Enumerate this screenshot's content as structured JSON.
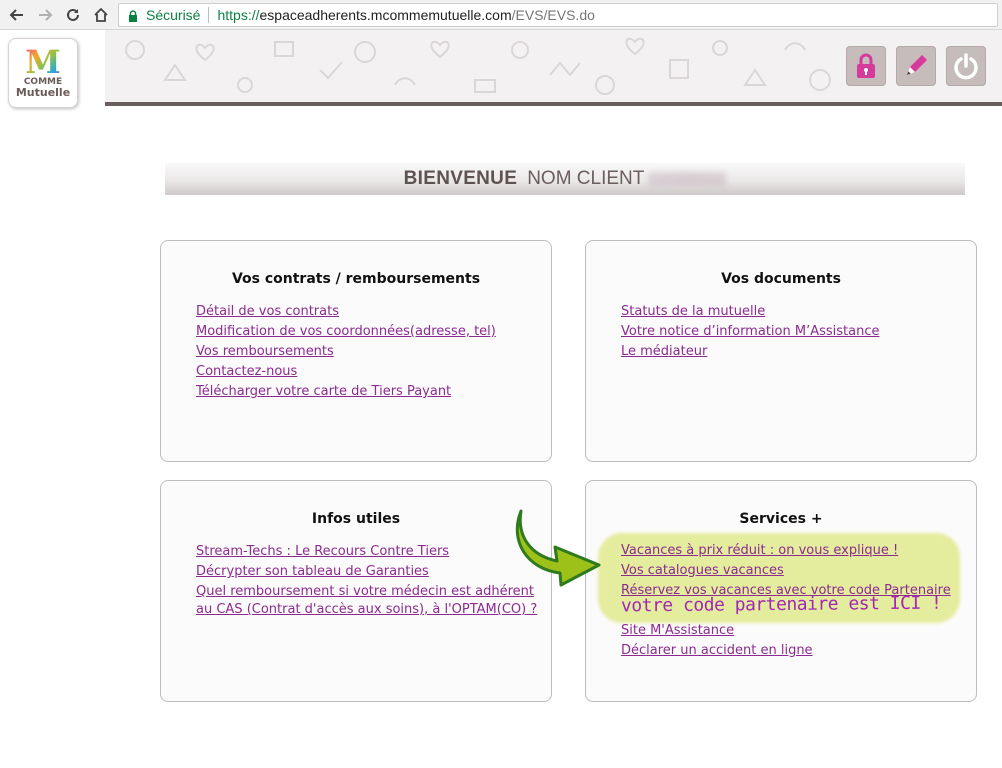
{
  "browser": {
    "secure_label": "Sécurisé",
    "url_scheme": "https://",
    "url_host": "espaceadherents.mcommemutuelle.com",
    "url_path": "/EVS/EVS.do"
  },
  "logo": {
    "letter": "M",
    "line1": "COMME",
    "line2": "Mutuelle"
  },
  "header": {
    "buttons": [
      {
        "name": "lock-icon",
        "color": "#d63a9a"
      },
      {
        "name": "pen-icon",
        "color": "#d63a9a"
      },
      {
        "name": "power-icon",
        "color": "#ffffff"
      }
    ]
  },
  "welcome": {
    "title": "BIENVENUE",
    "client_name": "NOM CLIENT"
  },
  "cards": {
    "contrats": {
      "title": "Vos contrats / remboursements",
      "links": [
        "Détail de vos contrats",
        "Modification de vos coordonnées(adresse, tel)",
        "Vos remboursements",
        "Contactez-nous",
        "Télécharger votre carte de Tiers Payant"
      ]
    },
    "documents": {
      "title": "Vos documents",
      "links": [
        "Statuts de la mutuelle",
        "Votre notice d’information M’Assistance",
        "Le médiateur"
      ]
    },
    "infos": {
      "title": "Infos utiles",
      "links": [
        "Stream-Techs : Le Recours Contre Tiers",
        "Décrypter son tableau de Garanties",
        "Quel remboursement si votre médecin est adhérent",
        "au CAS (Contrat d'accès aux soins), à l'OPTAM(CO) ?"
      ]
    },
    "services": {
      "title": "Services +",
      "links": [
        "Vacances à prix réduit : on vous explique !",
        "Vos catalogues vacances",
        "Réservez vos vacances avec votre code Partenaire",
        "Site M'Assistance",
        "Déclarer un accident en ligne"
      ],
      "annotation": "votre code partenaire est ICI !"
    }
  },
  "colors": {
    "link": "#8b2b8f",
    "highlight": "#dbe678",
    "arrow": "#9ec11a",
    "annotation": "#a327b5",
    "banner_border": "#6b5e5e"
  }
}
